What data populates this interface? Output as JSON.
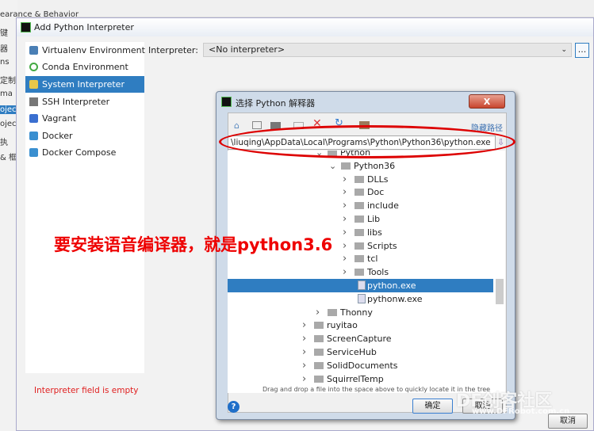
{
  "background": {
    "left_fragments": [
      "键",
      "器",
      "ns",
      "定制",
      "ma",
      "ojec",
      "ojec",
      "执",
      "& 框"
    ],
    "top_fragment": "earance & Behavior"
  },
  "main_dialog": {
    "title": "Add Python Interpreter",
    "items": [
      {
        "label": "Virtualenv Environment",
        "icon": "virtualenv-icon"
      },
      {
        "label": "Conda Environment",
        "icon": "conda-icon"
      },
      {
        "label": "System Interpreter",
        "icon": "python-icon",
        "selected": true
      },
      {
        "label": "SSH Interpreter",
        "icon": "terminal-icon"
      },
      {
        "label": "Vagrant",
        "icon": "vagrant-icon"
      },
      {
        "label": "Docker",
        "icon": "docker-icon"
      },
      {
        "label": "Docker Compose",
        "icon": "docker-icon"
      }
    ],
    "interpreter_label": "Interpreter:",
    "interpreter_value": "<No interpreter>",
    "browse_label": "...",
    "error": "Interpreter field is empty",
    "cancel_label": "取消"
  },
  "file_dialog": {
    "title": "选择 Python 解释器",
    "close_label": "X",
    "hide_path": "隐藏路径",
    "path": "\\liuqing\\AppData\\Local\\Programs\\Python\\Python36\\python.exe",
    "tree": [
      {
        "label": "Python",
        "level": 1,
        "type": "folder",
        "expanded": true
      },
      {
        "label": "Python36",
        "level": 2,
        "type": "folder",
        "expanded": true
      },
      {
        "label": "DLLs",
        "level": 3,
        "type": "folder"
      },
      {
        "label": "Doc",
        "level": 3,
        "type": "folder"
      },
      {
        "label": "include",
        "level": 3,
        "type": "folder"
      },
      {
        "label": "Lib",
        "level": 3,
        "type": "folder"
      },
      {
        "label": "libs",
        "level": 3,
        "type": "folder"
      },
      {
        "label": "Scripts",
        "level": 3,
        "type": "folder"
      },
      {
        "label": "tcl",
        "level": 3,
        "type": "folder"
      },
      {
        "label": "Tools",
        "level": 3,
        "type": "folder"
      },
      {
        "label": "python.exe",
        "level": 3,
        "type": "file",
        "selected": true
      },
      {
        "label": "pythonw.exe",
        "level": 3,
        "type": "file"
      },
      {
        "label": "Thonny",
        "level": 1,
        "type": "folder"
      },
      {
        "label": "ruyitao",
        "level": 0,
        "type": "folder"
      },
      {
        "label": "ScreenCapture",
        "level": 0,
        "type": "folder"
      },
      {
        "label": "ServiceHub",
        "level": 0,
        "type": "folder"
      },
      {
        "label": "SolidDocuments",
        "level": 0,
        "type": "folder"
      },
      {
        "label": "SquirrelTemp",
        "level": 0,
        "type": "folder"
      }
    ],
    "hint": "Drag and drop a file into the space above to quickly locate it in the tree",
    "ok_label": "确定",
    "cancel_label": "取消"
  },
  "annotation": "要安装语音编译器，就是python3.6",
  "watermark": {
    "brand": "DF创客社区",
    "url": "www.DFRobot.com.cn"
  },
  "colors": {
    "selection": "#2f7dc1",
    "annotation": "#e00000",
    "error": "#e02020"
  }
}
